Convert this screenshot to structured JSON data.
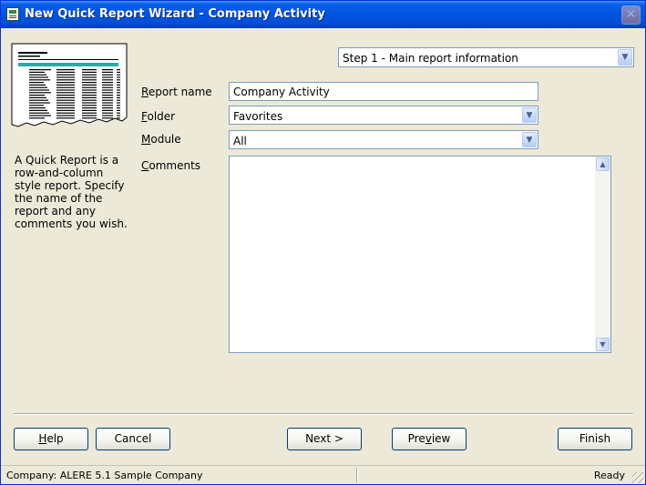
{
  "window": {
    "title": "New Quick Report Wizard - Company Activity",
    "close_symbol": "✕"
  },
  "sidebar": {
    "description": "A Quick Report is a row-and-column style report. Specify the name of the report and any comments you wish."
  },
  "step": {
    "selected": "Step 1 - Main report information"
  },
  "form": {
    "report_name": {
      "label_u": "R",
      "label_rest": "eport name",
      "value": "Company Activity"
    },
    "folder": {
      "label_u": "F",
      "label_rest": "older",
      "value": "Favorites"
    },
    "module": {
      "label_u": "M",
      "label_rest": "odule",
      "value": "All"
    },
    "comments": {
      "label_u": "C",
      "label_rest": "omments",
      "value": ""
    }
  },
  "buttons": {
    "help_u": "H",
    "help_rest": "elp",
    "cancel": "Cancel",
    "next": "Next >",
    "preview_a": "Pre",
    "preview_u": "v",
    "preview_b": "iew",
    "finish": "Finish"
  },
  "icons": {
    "dropdown": "chevron-down-icon",
    "scroll_up": "scroll-up-icon",
    "scroll_down": "scroll-down-icon"
  },
  "status": {
    "company": "Company: ALERE 5.1 Sample Company",
    "state": "Ready"
  },
  "colors": {
    "title_bar": "#0054e3",
    "dialog_bg": "#ece9d8",
    "field_border": "#7f9db9",
    "report_accent": "#2aaaa6"
  }
}
